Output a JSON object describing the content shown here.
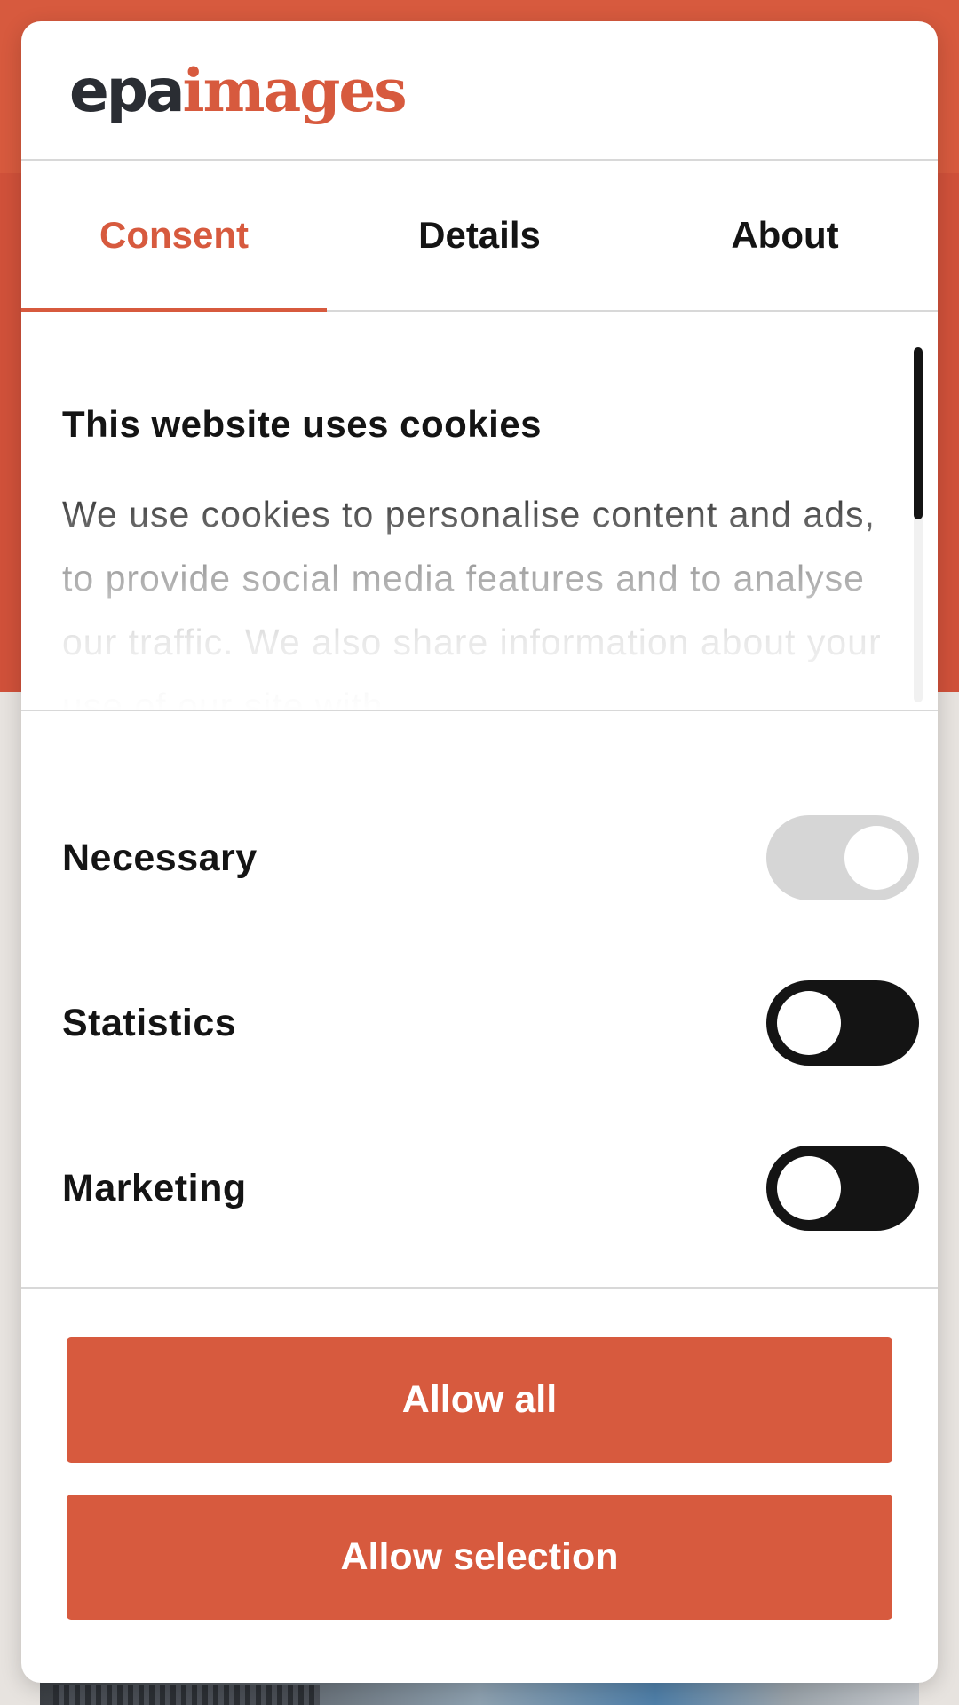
{
  "logo": {
    "part1": "epa",
    "part2": "images"
  },
  "tabs": [
    {
      "label": "Consent",
      "active": true
    },
    {
      "label": "Details",
      "active": false
    },
    {
      "label": "About",
      "active": false
    }
  ],
  "content": {
    "title": "This website uses cookies",
    "text": "We use cookies to personalise content and ads, to provide social media features and to analyse our traffic. We also share information about your use of our site with"
  },
  "toggles": [
    {
      "label": "Necessary",
      "state": "on",
      "disabled": true
    },
    {
      "label": "Statistics",
      "state": "off",
      "disabled": false
    },
    {
      "label": "Marketing",
      "state": "off",
      "disabled": false
    }
  ],
  "buttons": {
    "allow_all": "Allow all",
    "allow_selection": "Allow selection"
  },
  "colors": {
    "accent": "#d75a3e",
    "text": "#141414",
    "toggle_off": "#141414",
    "toggle_disabled": "#d6d6d6"
  }
}
